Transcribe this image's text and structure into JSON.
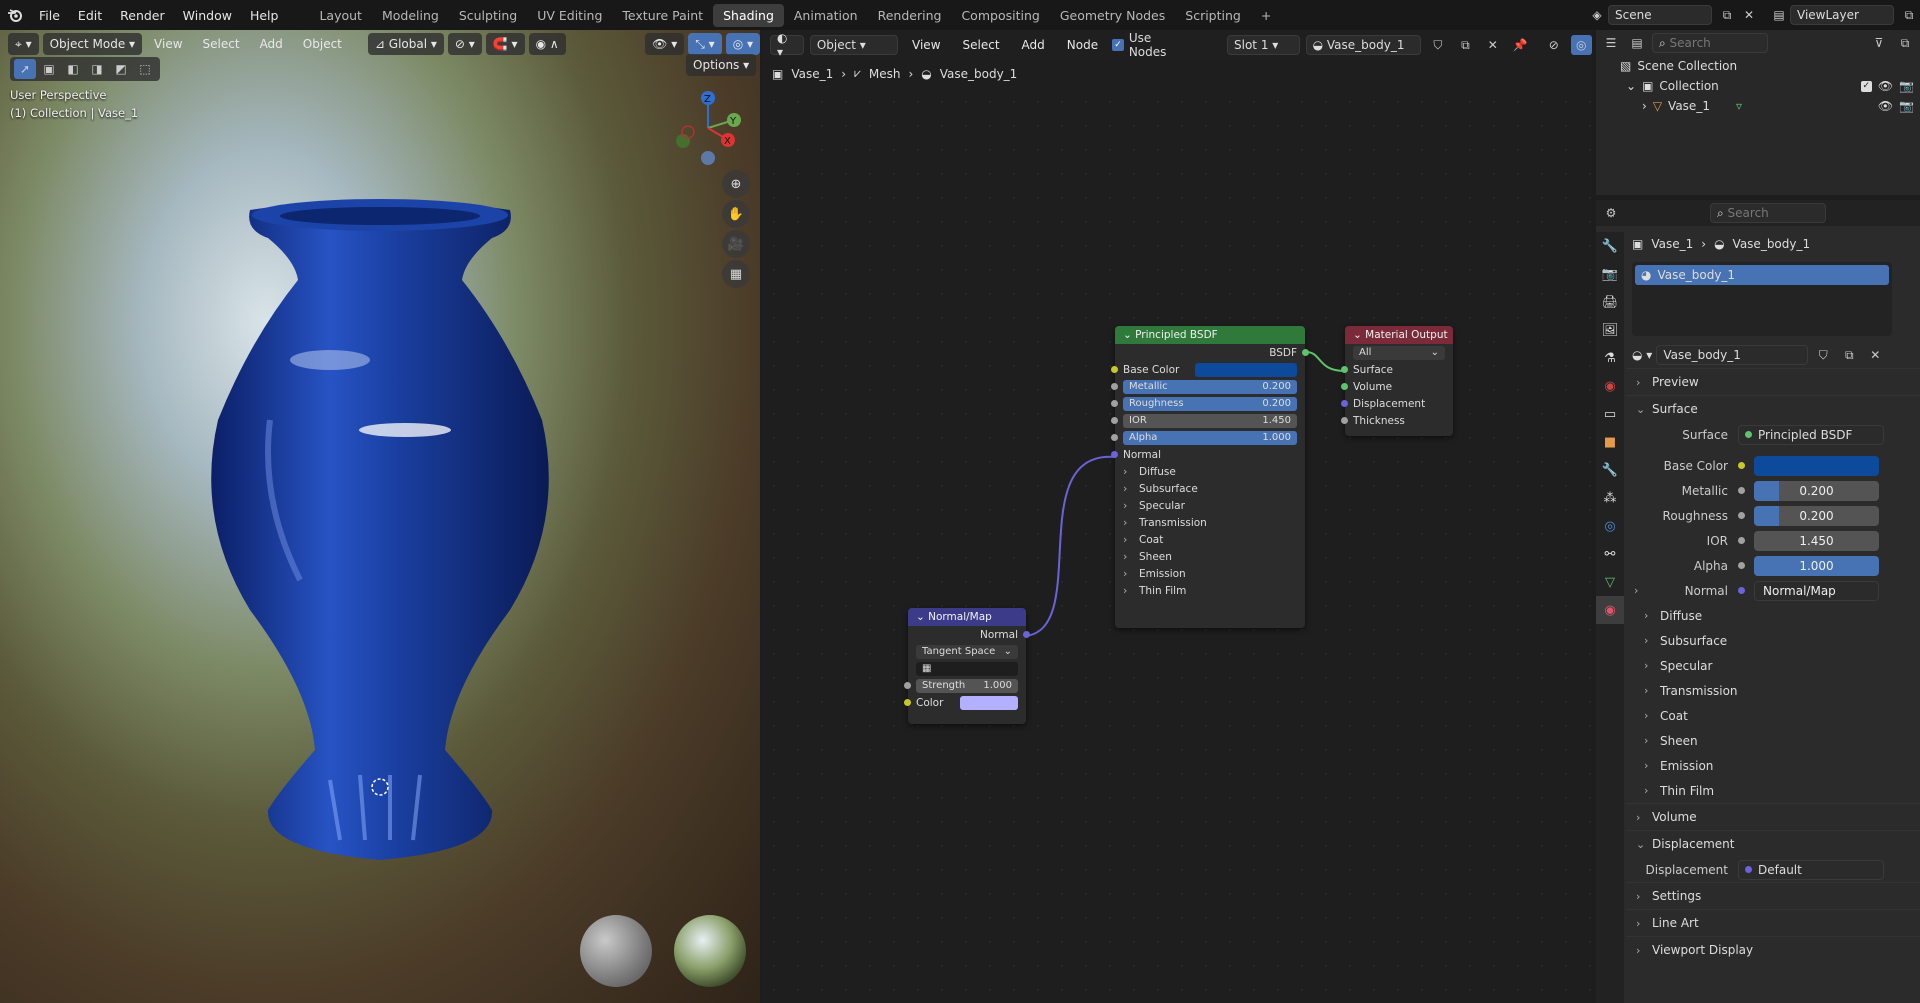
{
  "menubar": {
    "menus": [
      "File",
      "Edit",
      "Render",
      "Window",
      "Help"
    ],
    "workspaces": [
      "Layout",
      "Modeling",
      "Sculpting",
      "UV Editing",
      "Texture Paint",
      "Shading",
      "Animation",
      "Rendering",
      "Compositing",
      "Geometry Nodes",
      "Scripting"
    ],
    "active_workspace": "Shading",
    "scene": "Scene",
    "view_layer": "ViewLayer"
  },
  "viewport": {
    "mode": "Object Mode",
    "menus": [
      "View",
      "Select",
      "Add",
      "Object"
    ],
    "transform": "Global",
    "options": "Options",
    "perspective": "User Perspective",
    "collection": "(1) Collection | Vase_1",
    "axis_z": "Z",
    "axis_y": "Y",
    "axis_x": "X"
  },
  "node_editor": {
    "type": "Object",
    "menus": [
      "View",
      "Select",
      "Add",
      "Node"
    ],
    "use_nodes": "Use Nodes",
    "slot": "Slot 1",
    "material": "Vase_body_1",
    "breadcrumb": [
      "Vase_1",
      "Mesh",
      "Vase_body_1"
    ],
    "bsdf": {
      "title": "Principled BSDF",
      "output": "BSDF",
      "base_color_label": "Base Color",
      "metallic_label": "Metallic",
      "metallic": "0.200",
      "roughness_label": "Roughness",
      "roughness": "0.200",
      "ior_label": "IOR",
      "ior": "1.450",
      "alpha_label": "Alpha",
      "alpha": "1.000",
      "normal_label": "Normal",
      "panels": [
        "Diffuse",
        "Subsurface",
        "Specular",
        "Transmission",
        "Coat",
        "Sheen",
        "Emission",
        "Thin Film"
      ]
    },
    "output": {
      "title": "Material Output",
      "target": "All",
      "inputs": [
        "Surface",
        "Volume",
        "Displacement",
        "Thickness"
      ]
    },
    "normal_map": {
      "title": "Normal/Map",
      "output": "Normal",
      "space": "Tangent Space",
      "strength_label": "Strength",
      "strength": "1.000",
      "color_label": "Color"
    }
  },
  "outliner": {
    "search_placeholder": "Search",
    "scene_collection": "Scene Collection",
    "collection": "Collection",
    "object": "Vase_1"
  },
  "properties": {
    "search_placeholder": "Search",
    "breadcrumb_object": "Vase_1",
    "breadcrumb_material": "Vase_body_1",
    "slot_item": "Vase_body_1",
    "material_name": "Vase_body_1",
    "preview": "Preview",
    "surface_section": "Surface",
    "surface_label": "Surface",
    "surface_value": "Principled BSDF",
    "base_color_label": "Base Color",
    "metallic_label": "Metallic",
    "metallic": "0.200",
    "roughness_label": "Roughness",
    "roughness": "0.200",
    "ior_label": "IOR",
    "ior": "1.450",
    "alpha_label": "Alpha",
    "alpha": "1.000",
    "normal_label": "Normal",
    "normal_value": "Normal/Map",
    "panels": [
      "Diffuse",
      "Subsurface",
      "Specular",
      "Transmission",
      "Coat",
      "Sheen",
      "Emission",
      "Thin Film"
    ],
    "volume": "Volume",
    "displacement_section": "Displacement",
    "displacement_label": "Displacement",
    "displacement_value": "Default",
    "settings": "Settings",
    "line_art": "Line Art",
    "viewport_display": "Viewport Display"
  },
  "colors": {
    "base_color": "#0e4a9c",
    "vase": "#1a3fa0",
    "accent": "#4772b3",
    "bsdf_header": "#2f7a3a",
    "output_header": "#7a2a38",
    "normal_header": "#3c3b8a"
  }
}
